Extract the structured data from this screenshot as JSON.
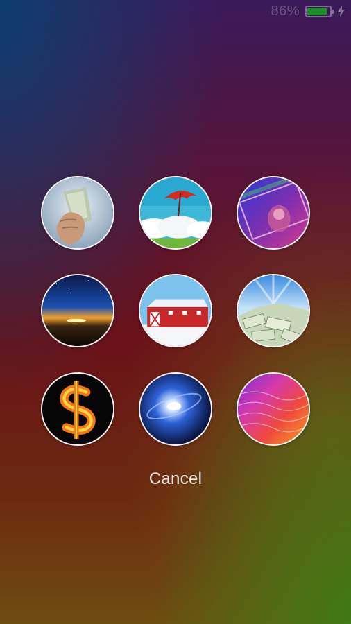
{
  "status_bar": {
    "battery_percent_text": "86%",
    "battery_level": 0.86,
    "charging_icon": "lightning-bolt-icon"
  },
  "wallpapers": [
    {
      "name": "hand-with-money",
      "icon": "wallpaper-thumbnail"
    },
    {
      "name": "red-umbrella-sky",
      "icon": "wallpaper-thumbnail"
    },
    {
      "name": "dollar-bill-color",
      "icon": "wallpaper-thumbnail"
    },
    {
      "name": "earth-sunrise-space",
      "icon": "wallpaper-thumbnail"
    },
    {
      "name": "red-barn-snow",
      "icon": "wallpaper-thumbnail"
    },
    {
      "name": "pile-of-dollars",
      "icon": "wallpaper-thumbnail"
    },
    {
      "name": "fire-dollar-sign",
      "icon": "wallpaper-thumbnail"
    },
    {
      "name": "blue-galaxy",
      "icon": "wallpaper-thumbnail"
    },
    {
      "name": "rainbow-waves",
      "icon": "wallpaper-thumbnail"
    }
  ],
  "cancel_label": "Cancel"
}
